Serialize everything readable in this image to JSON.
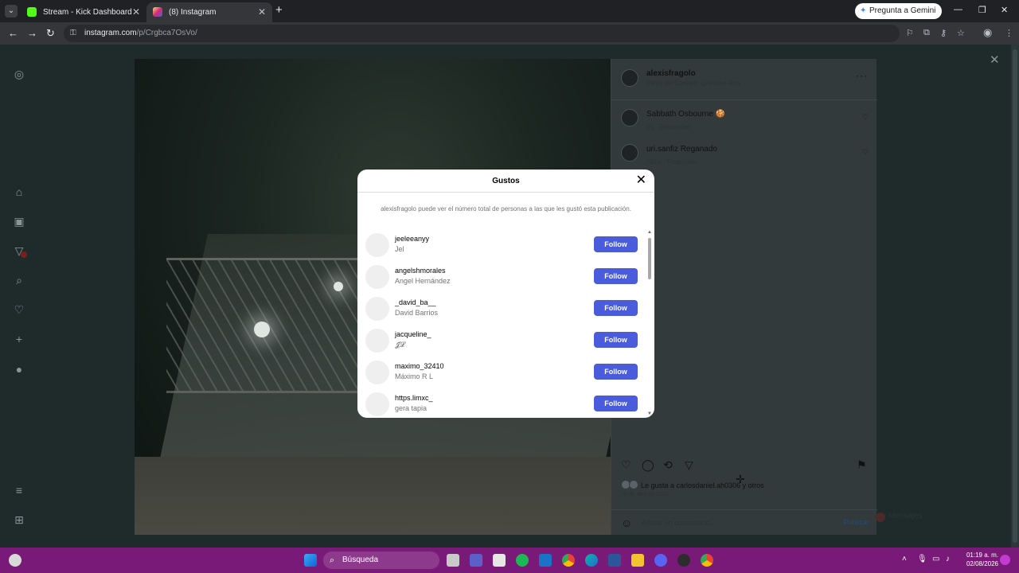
{
  "browser": {
    "tabs": [
      {
        "title": "Stream - Kick Dashboard",
        "active": false
      },
      {
        "title": "(8) Instagram",
        "active": true
      }
    ],
    "gemini_button": "Pregunta a Gemini",
    "url_host": "instagram.com",
    "url_path": "/p/Crgbca7OsVo/"
  },
  "post": {
    "author": "alexisfragolo",
    "location": "Playa del Carmen, Quintana Roo",
    "comments": [
      {
        "user": "Sabbath Osbourne 🍪",
        "meta": "2s · Responder"
      },
      {
        "user": "uri.sanfiz Reganado",
        "meta": "181w · Responder"
      }
    ],
    "likes_text": "Le gusta a carlosdaniel.ah0306 y otros",
    "date": "26 de abril de 2023",
    "comment_placeholder": "Añade un comentario...",
    "post_button": "Publicar",
    "messages_label": "Mensajes"
  },
  "likes_modal": {
    "title": "Gustos",
    "note": "alexisfragolo puede ver el número total de personas a las que les gustó esta publicación.",
    "users": [
      {
        "username": "jeeleeanyy",
        "name": "Jel",
        "button": "Follow"
      },
      {
        "username": "angelshmorales",
        "name": "Angel Hernández",
        "button": "Follow"
      },
      {
        "username": "_david_ba__",
        "name": "David Barrios",
        "button": "Follow"
      },
      {
        "username": "jacqueline_",
        "name": "𝓙𝓛",
        "button": "Follow"
      },
      {
        "username": "maximo_32410",
        "name": "Máximo R L",
        "button": "Follow"
      },
      {
        "username": "https.limxc_",
        "name": "gera tapia",
        "button": "Follow"
      }
    ]
  },
  "taskbar": {
    "search_label": "Búsqueda",
    "time": "01:19 a. m.",
    "date": "02/08/2026"
  },
  "colors": {
    "follow_button": "#4a5bdc",
    "taskbar": "#7a1a78",
    "overlay_panel": "#333a3b"
  }
}
